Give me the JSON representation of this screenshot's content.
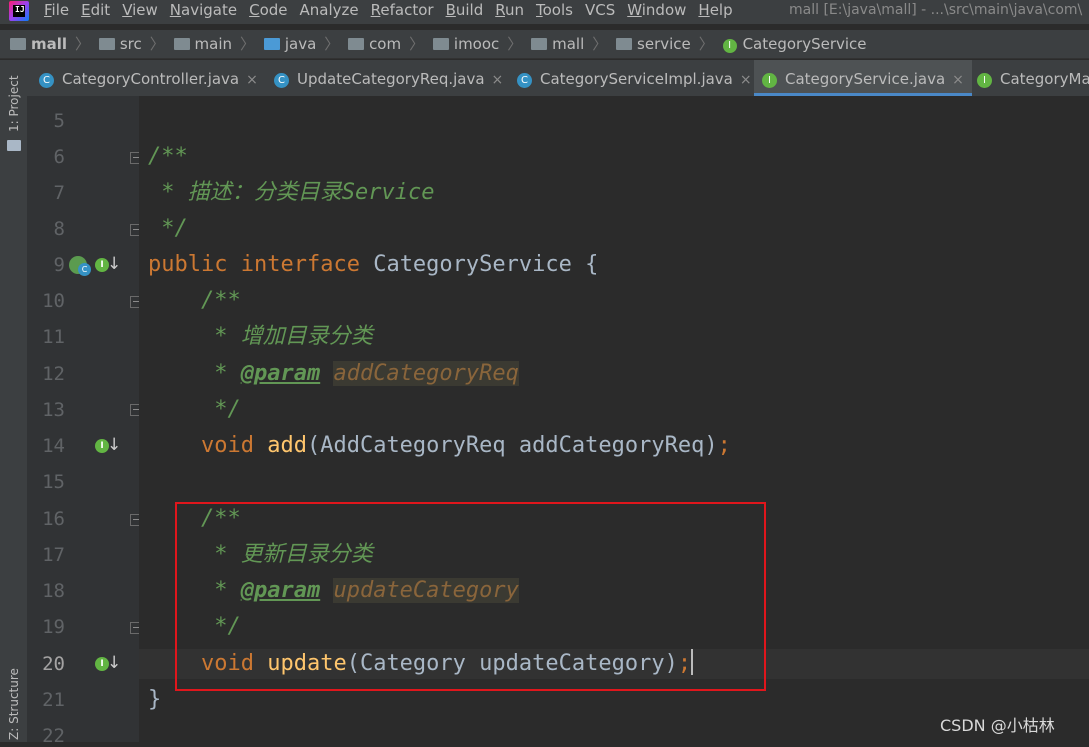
{
  "menubar": {
    "items": [
      {
        "u": "F",
        "rest": "ile"
      },
      {
        "u": "E",
        "rest": "dit"
      },
      {
        "u": "V",
        "rest": "iew"
      },
      {
        "u": "N",
        "rest": "avigate"
      },
      {
        "u": "C",
        "rest": "ode"
      },
      {
        "u": "",
        "rest": "Analyze"
      },
      {
        "u": "R",
        "rest": "efactor"
      },
      {
        "u": "B",
        "rest": "uild"
      },
      {
        "u": "R",
        "rest": "un"
      },
      {
        "u": "T",
        "rest": "ools"
      },
      {
        "u": "",
        "rest": "VCS"
      },
      {
        "u": "W",
        "rest": "indow"
      },
      {
        "u": "H",
        "rest": "elp"
      }
    ],
    "window_title": "mall [E:\\java\\mall] - ...\\src\\main\\java\\com\\"
  },
  "breadcrumb": {
    "items": [
      "mall",
      "src",
      "main",
      "java",
      "com",
      "imooc",
      "mall",
      "service",
      "CategoryService"
    ]
  },
  "left_strip": {
    "project_label": "1: Project",
    "structure_label": "Z: Structure"
  },
  "tabs": [
    {
      "label": "CategoryController.java",
      "badge": "C",
      "active": false
    },
    {
      "label": "UpdateCategoryReq.java",
      "badge": "C",
      "active": false
    },
    {
      "label": "CategoryServiceImpl.java",
      "badge": "C",
      "active": false
    },
    {
      "label": "CategoryService.java",
      "badge": "I",
      "active": true
    },
    {
      "label": "CategoryMa",
      "badge": "I",
      "active": false
    }
  ],
  "editor": {
    "line_numbers": [
      "5",
      "6",
      "7",
      "8",
      "9",
      "10",
      "11",
      "12",
      "13",
      "14",
      "15",
      "16",
      "17",
      "18",
      "19",
      "20",
      "21",
      "22"
    ],
    "current_line": "20",
    "code": {
      "l6": "/**",
      "l7_star": " * ",
      "l7_text": "描述：分类目录Service",
      "l8": " */",
      "l9_kw1": "public",
      "l9_kw2": "interface",
      "l9_rest": " CategoryService {",
      "l10": "    /**",
      "l11_star": "     * ",
      "l11_text": "增加目录分类",
      "l12_star": "     * ",
      "l12_tag": "@param",
      "l12_param": "addCategoryReq",
      "l13": "     */",
      "l14_kw": "    void",
      "l14_fn": "add",
      "l14_rest": "(AddCategoryReq addCategoryReq)",
      "l14_semi": ";",
      "l16": "    /**",
      "l17_star": "     * ",
      "l17_text": "更新目录分类",
      "l18_star": "     * ",
      "l18_tag": "@param",
      "l18_param": "updateCategory",
      "l19": "     */",
      "l20_kw": "    void",
      "l20_fn": "update",
      "l20_rest": "(Category updateCategory)",
      "l20_semi": ";",
      "l21": "}"
    }
  },
  "watermark": "CSDN @小枯林",
  "colors": {
    "keyword": "#cc7832",
    "function": "#ffc66d",
    "comment": "#629755",
    "highlight_box": "#e0161c",
    "active_tab_underline": "#4a88c7"
  },
  "icons": [
    "intellij-logo",
    "folder-icon",
    "interface-icon",
    "class-icon",
    "close-icon",
    "implemented-arrow-icon",
    "bean-icon"
  ]
}
